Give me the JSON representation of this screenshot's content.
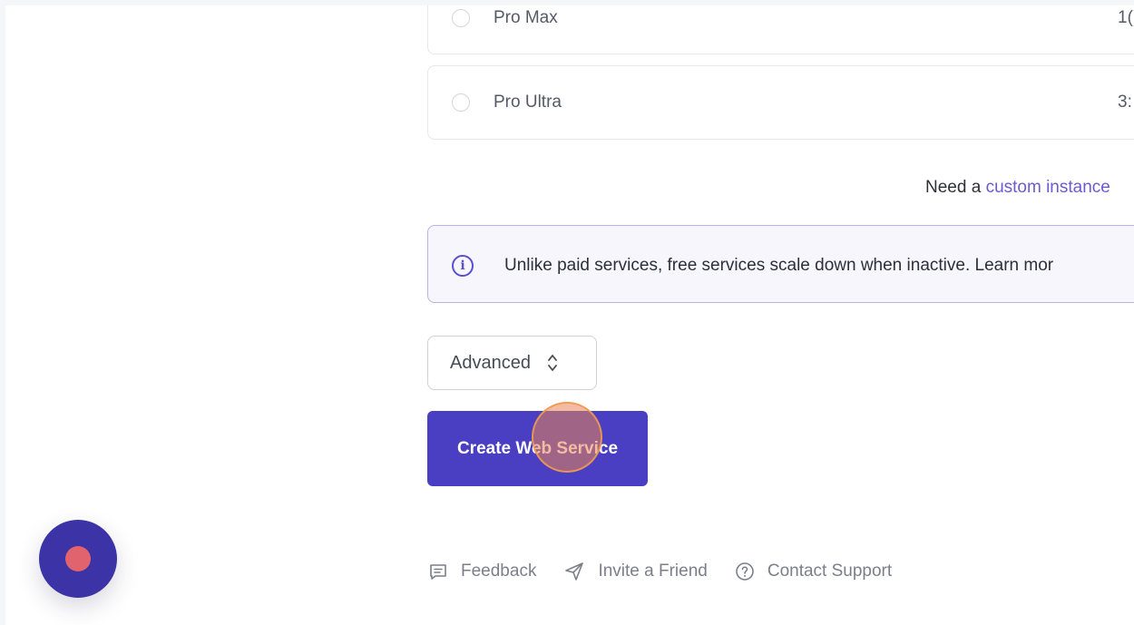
{
  "plans": [
    {
      "name": "Pro Max",
      "price": "1("
    },
    {
      "name": "Pro Ultra",
      "price": "3:"
    }
  ],
  "custom_instance": {
    "prefix": "Need a",
    "link": "custom instance"
  },
  "info": {
    "text": "Unlike paid services, free services scale down when inactive. Learn mor"
  },
  "advanced": {
    "label": "Advanced"
  },
  "create": {
    "label": "Create Web Service"
  },
  "footer": {
    "feedback": "Feedback",
    "invite": "Invite a Friend",
    "support": "Contact Support"
  },
  "colors": {
    "primary": "#4a3fc3",
    "link": "#6b5bd2",
    "launcher": "#3b33a6",
    "launcher_dot": "#e0636e",
    "click_indicator": "#e88456"
  }
}
